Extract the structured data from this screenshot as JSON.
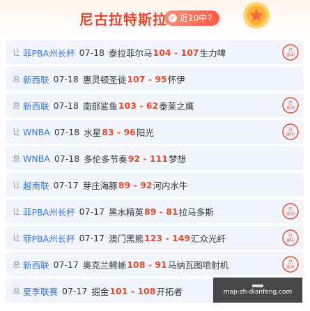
{
  "header": {
    "title": "尼古拉特斯拉",
    "badge": "近10中7"
  },
  "colors": {
    "accent": "#e34a2f",
    "league": "#3476d2",
    "row_bg": "#f2f6fc"
  },
  "matches": [
    {
      "tag": "让",
      "league": "菲PBA州长杯",
      "date": "07-18",
      "home": "泰拉菲尔马",
      "score": "104 - 107",
      "away": "生力啤",
      "stamp": "hit"
    },
    {
      "tag": "总",
      "league": "新西联",
      "date": "07-18",
      "home": "惠灵顿圣徒",
      "score": "107 - 95",
      "away": "怀伊",
      "stamp": ""
    },
    {
      "tag": "总",
      "league": "新西联",
      "date": "07-18",
      "home": "南部鲨鱼",
      "score": "103 - 62",
      "away": "泰莱之鹰",
      "stamp": "hit"
    },
    {
      "tag": "让",
      "league": "WNBA",
      "date": "07-18",
      "home": "水星",
      "score": "83 - 96",
      "away": "阳光",
      "stamp": "hit"
    },
    {
      "tag": "总",
      "league": "WNBA",
      "date": "07-18",
      "home": "多伦多节奏",
      "score": "92 - 111",
      "away": "梦想",
      "stamp": ""
    },
    {
      "tag": "让",
      "league": "越南联",
      "date": "07-17",
      "home": "芽庄海豚",
      "score": "89 - 92",
      "away": "河内水牛",
      "stamp": ""
    },
    {
      "tag": "让",
      "league": "菲PBA州长杯",
      "date": "07-17",
      "home": "黑水精英",
      "score": "89 - 81",
      "away": "拉马多斯",
      "stamp": "hit"
    },
    {
      "tag": "让",
      "league": "菲PBA州长杯",
      "date": "07-17",
      "home": "澳门黑熊",
      "score": "123 - 149",
      "away": "汇众光纤",
      "stamp": "hit"
    },
    {
      "tag": "总",
      "league": "新西联",
      "date": "07-17",
      "home": "奥克兰鳄蜥",
      "score": "108 - 91",
      "away": "马纳瓦图喷射机",
      "stamp": "hit"
    },
    {
      "tag": "总",
      "league": "夏季联赛",
      "date": "07-17",
      "home": "掘金",
      "score": "101 - 108",
      "away": "开拓者",
      "stamp": ""
    }
  ],
  "stamp": {
    "line1": "已",
    "line2": "命中"
  },
  "watermark": {
    "text": "map-zh-dianfeng.com"
  }
}
